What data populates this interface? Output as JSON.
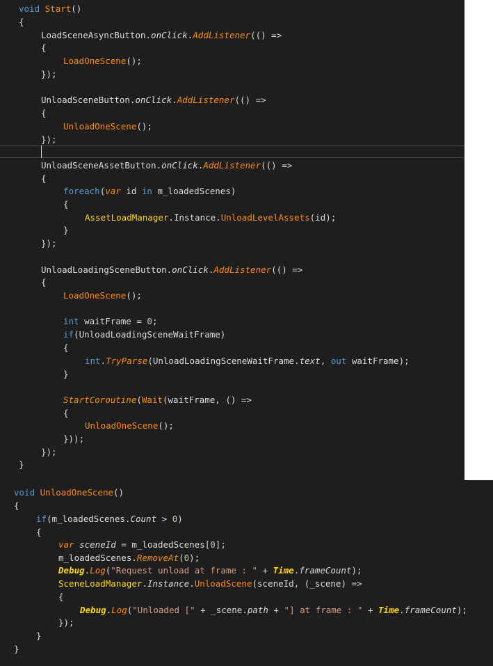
{
  "panels": [
    {
      "name": "start-method",
      "lines": [
        {
          "t": [
            [
              "kw",
              "void"
            ],
            [
              "id",
              " "
            ],
            [
              "fn",
              "Start"
            ],
            [
              "pu",
              "()"
            ]
          ]
        },
        {
          "t": [
            [
              "pu",
              "{"
            ]
          ]
        },
        {
          "t": [
            [
              "id",
              "LoadSceneAsyncButton."
            ],
            [
              "mi",
              "onClick"
            ],
            [
              "pu",
              "."
            ],
            [
              "it",
              "AddListener"
            ],
            [
              "pu",
              "(() =>"
            ]
          ]
        },
        {
          "t": [
            [
              "pu",
              "{"
            ]
          ]
        },
        {
          "t": [
            [
              "fn",
              "LoadOneScene"
            ],
            [
              "pu",
              "();"
            ]
          ]
        },
        {
          "t": [
            [
              "pu",
              "});"
            ]
          ]
        },
        {
          "t": []
        },
        {
          "t": [
            [
              "id",
              "UnloadSceneButton."
            ],
            [
              "mi",
              "onClick"
            ],
            [
              "pu",
              "."
            ],
            [
              "it",
              "AddListener"
            ],
            [
              "pu",
              "(() =>"
            ]
          ]
        },
        {
          "t": [
            [
              "pu",
              "{"
            ]
          ]
        },
        {
          "t": [
            [
              "fn",
              "UnloadOneScene"
            ],
            [
              "pu",
              "();"
            ]
          ]
        },
        {
          "t": [
            [
              "pu",
              "});"
            ]
          ]
        },
        {
          "t": []
        },
        {
          "t": [
            [
              "id",
              "UnloadSceneAssetButton."
            ],
            [
              "mi",
              "onClick"
            ],
            [
              "pu",
              "."
            ],
            [
              "it",
              "AddListener"
            ],
            [
              "pu",
              "(() =>"
            ]
          ]
        },
        {
          "t": [
            [
              "pu",
              "{"
            ]
          ]
        },
        {
          "t": [
            [
              "kw",
              "foreach"
            ],
            [
              "pu",
              "("
            ],
            [
              "it",
              "var"
            ],
            [
              "id",
              " id "
            ],
            [
              "kw",
              "in"
            ],
            [
              "id",
              " m_loadedScenes)"
            ]
          ]
        },
        {
          "t": [
            [
              "pu",
              "{"
            ]
          ]
        },
        {
          "t": [
            [
              "cl",
              "AssetLoadManager"
            ],
            [
              "pu",
              "."
            ],
            [
              "id",
              "Instance"
            ],
            [
              "pu",
              "."
            ],
            [
              "fn",
              "UnloadLevelAssets"
            ],
            [
              "pu",
              "(id);"
            ]
          ]
        },
        {
          "t": [
            [
              "pu",
              "}"
            ]
          ]
        },
        {
          "t": [
            [
              "pu",
              "});"
            ]
          ]
        },
        {
          "t": []
        },
        {
          "t": [
            [
              "id",
              "UnloadLoadingSceneButton."
            ],
            [
              "mi",
              "onClick"
            ],
            [
              "pu",
              "."
            ],
            [
              "it",
              "AddListener"
            ],
            [
              "pu",
              "(() =>"
            ]
          ]
        },
        {
          "t": [
            [
              "pu",
              "{"
            ]
          ]
        },
        {
          "t": [
            [
              "fn",
              "LoadOneScene"
            ],
            [
              "pu",
              "();"
            ]
          ]
        },
        {
          "t": []
        },
        {
          "t": [
            [
              "kw",
              "int"
            ],
            [
              "id",
              " waitFrame = "
            ],
            [
              "nu",
              "0"
            ],
            [
              "pu",
              ";"
            ]
          ]
        },
        {
          "t": [
            [
              "kw",
              "if"
            ],
            [
              "pu",
              "("
            ],
            [
              "id",
              "UnloadLoadingSceneWaitFrame)"
            ]
          ]
        },
        {
          "t": [
            [
              "pu",
              "{"
            ]
          ]
        },
        {
          "t": [
            [
              "kw",
              "int"
            ],
            [
              "pu",
              "."
            ],
            [
              "it",
              "TryParse"
            ],
            [
              "pu",
              "("
            ],
            [
              "id",
              "UnloadLoadingSceneWaitFrame."
            ],
            [
              "mi",
              "text"
            ],
            [
              "pu",
              ", "
            ],
            [
              "kw",
              "out"
            ],
            [
              "id",
              " waitFrame);"
            ]
          ]
        },
        {
          "t": [
            [
              "pu",
              "}"
            ]
          ]
        },
        {
          "t": []
        },
        {
          "t": [
            [
              "it",
              "StartCoroutine"
            ],
            [
              "pu",
              "("
            ],
            [
              "fn",
              "Wait"
            ],
            [
              "pu",
              "("
            ],
            [
              "id",
              "waitFrame, () =>"
            ]
          ]
        },
        {
          "t": [
            [
              "pu",
              "{"
            ]
          ]
        },
        {
          "t": [
            [
              "fn",
              "UnloadOneScene"
            ],
            [
              "pu",
              "();"
            ]
          ]
        },
        {
          "t": [
            [
              "pu",
              "}));"
            ]
          ]
        },
        {
          "t": [
            [
              "pu",
              "});"
            ]
          ]
        },
        {
          "t": [
            [
              "pu",
              "}"
            ]
          ]
        }
      ]
    },
    {
      "name": "unload-one-scene-method",
      "lines": [
        {
          "t": [
            [
              "kw",
              "void"
            ],
            [
              "id",
              " "
            ],
            [
              "fn",
              "UnloadOneScene"
            ],
            [
              "pu",
              "()"
            ]
          ]
        },
        {
          "t": [
            [
              "pu",
              "{"
            ]
          ]
        },
        {
          "t": [
            [
              "kw",
              "if"
            ],
            [
              "pu",
              "("
            ],
            [
              "id",
              "m_loadedScenes."
            ],
            [
              "mi",
              "Count"
            ],
            [
              "id",
              " > "
            ],
            [
              "nu",
              "0"
            ],
            [
              "pu",
              ")"
            ]
          ]
        },
        {
          "t": [
            [
              "pu",
              "{"
            ]
          ]
        },
        {
          "t": [
            [
              "it",
              "var"
            ],
            [
              "mi",
              " sceneId"
            ],
            [
              "id",
              " = m_loadedScenes["
            ],
            [
              "nu",
              "0"
            ],
            [
              "pu",
              "];"
            ]
          ]
        },
        {
          "t": [
            [
              "id",
              "m_loadedScenes."
            ],
            [
              "it",
              "RemoveAt"
            ],
            [
              "pu",
              "("
            ],
            [
              "nu",
              "0"
            ],
            [
              "pu",
              ");"
            ]
          ]
        },
        {
          "t": [
            [
              "ty",
              "Debug"
            ],
            [
              "pu",
              "."
            ],
            [
              "it",
              "Log"
            ],
            [
              "pu",
              "("
            ],
            [
              "st",
              "\"Request unload at frame : \""
            ],
            [
              "id",
              " + "
            ],
            [
              "ty",
              "Time"
            ],
            [
              "pu",
              "."
            ],
            [
              "mi",
              "frameCount"
            ],
            [
              "pu",
              ");"
            ]
          ]
        },
        {
          "t": [
            [
              "cls",
              "SceneLoadManager"
            ],
            [
              "pu",
              "."
            ],
            [
              "mi",
              "Instance"
            ],
            [
              "pu",
              "."
            ],
            [
              "fn",
              "UnloadScene"
            ],
            [
              "pu",
              "("
            ],
            [
              "id",
              "sceneId, (_scene) =>"
            ]
          ]
        },
        {
          "t": [
            [
              "pu",
              "{"
            ]
          ]
        },
        {
          "t": [
            [
              "ty",
              "Debug"
            ],
            [
              "pu",
              "."
            ],
            [
              "it",
              "Log"
            ],
            [
              "pu",
              "("
            ],
            [
              "st",
              "\"Unloaded [\""
            ],
            [
              "id",
              " + _scene."
            ],
            [
              "mi",
              "path"
            ],
            [
              "id",
              " + "
            ],
            [
              "st",
              "\"] at frame : \""
            ],
            [
              "id",
              " + "
            ],
            [
              "ty",
              "Time"
            ],
            [
              "pu",
              "."
            ],
            [
              "mi",
              "frameCount"
            ],
            [
              "pu",
              ");"
            ]
          ]
        },
        {
          "t": [
            [
              "pu",
              "});"
            ]
          ]
        },
        {
          "t": [
            [
              "pu",
              "}"
            ]
          ]
        },
        {
          "t": [
            [
              "pu",
              "}"
            ]
          ]
        }
      ]
    }
  ]
}
